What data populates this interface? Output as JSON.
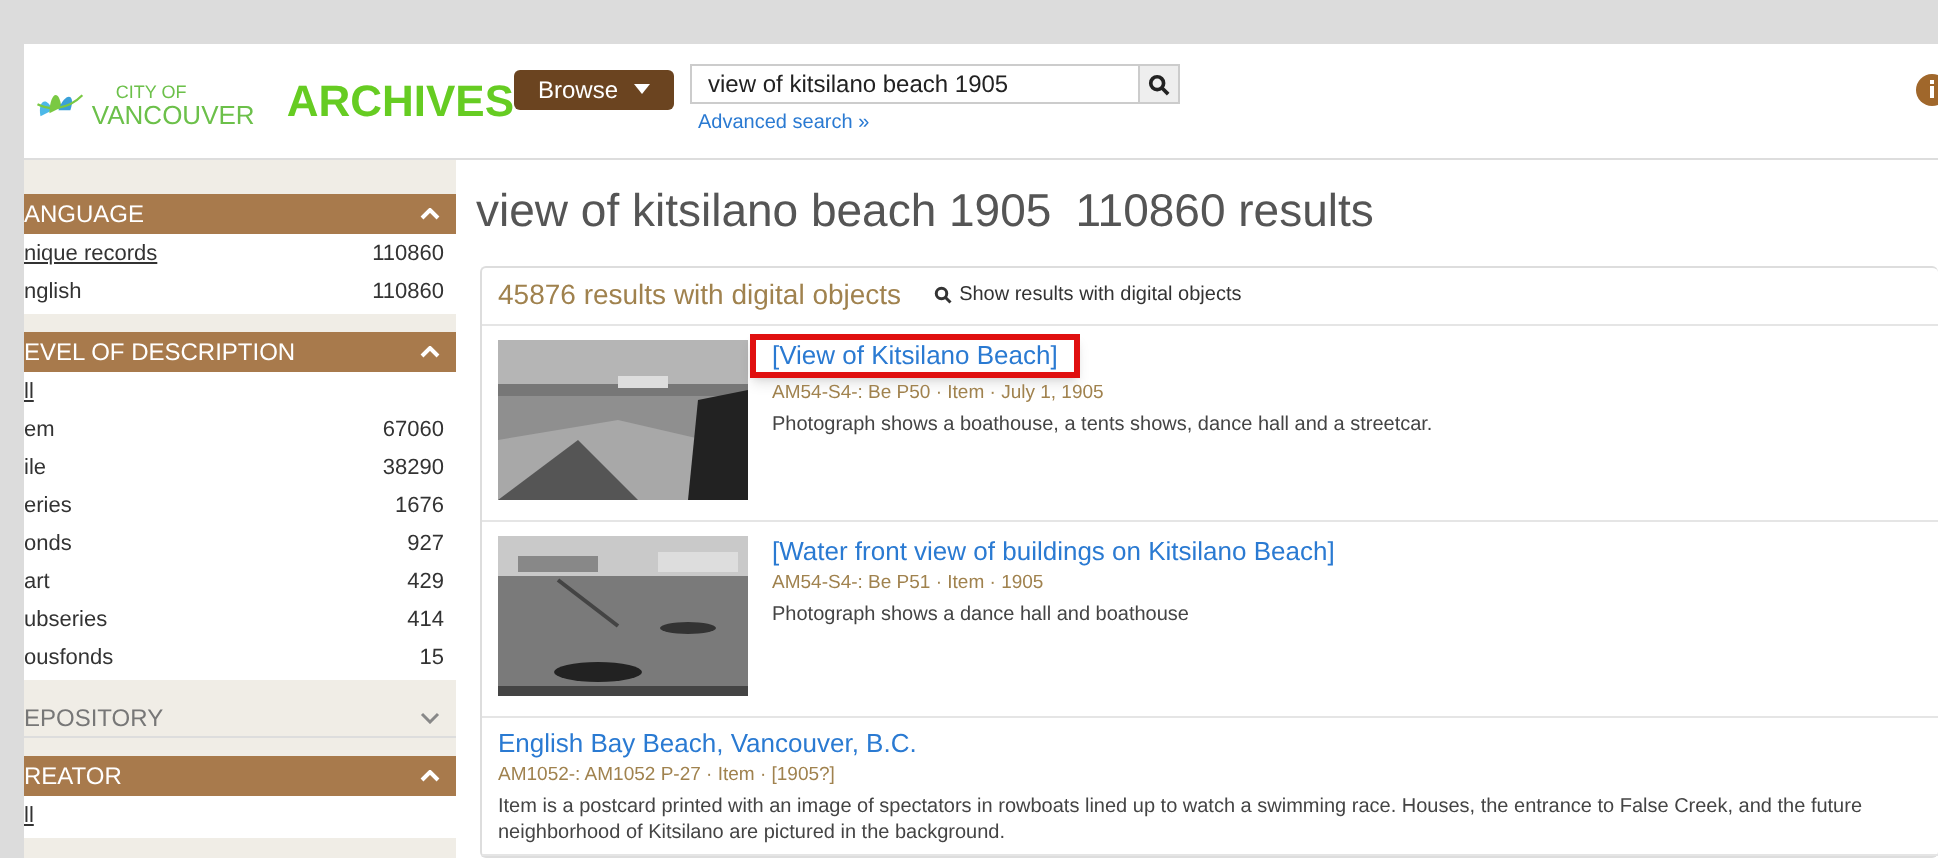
{
  "header": {
    "logo_small": "CITY OF",
    "logo_city": "VANCOUVER",
    "logo_title": "ARCHIVES",
    "browse_button": "Browse",
    "search": {
      "value": "view of kitsilano beach 1905"
    },
    "advanced_search": "Advanced search »"
  },
  "sidebar": {
    "facets": [
      {
        "title": "ANGUAGE",
        "expanded": true,
        "items": [
          {
            "label": "nique records",
            "count": "110860",
            "link": true
          },
          {
            "label": "nglish",
            "count": "110860",
            "link": false
          }
        ]
      },
      {
        "title": "EVEL OF DESCRIPTION",
        "expanded": true,
        "items": [
          {
            "label": "ll",
            "link": true
          },
          {
            "label": "em",
            "count": "67060",
            "link": false
          },
          {
            "label": "ile",
            "count": "38290",
            "link": false
          },
          {
            "label": "eries",
            "count": "1676",
            "link": false
          },
          {
            "label": "onds",
            "count": "927",
            "link": false
          },
          {
            "label": "art",
            "count": "429",
            "link": false
          },
          {
            "label": "ubseries",
            "count": "414",
            "link": false
          },
          {
            "label": "ousfonds",
            "count": "15",
            "link": false
          }
        ]
      },
      {
        "title": "EPOSITORY",
        "expanded": false
      },
      {
        "title": "REATOR",
        "expanded": true,
        "items": [
          {
            "label": "ll",
            "link": true
          }
        ]
      }
    ]
  },
  "results": {
    "heading": "view of kitsilano beach 1905",
    "total": "110860 results",
    "digital_count": "45876 results with digital objects",
    "digital_link": "Show results with digital objects",
    "items": [
      {
        "title": "[View of Kitsilano Beach]",
        "meta": "AM54-S4-: Be P50 · Item · July 1, 1905",
        "description": "Photograph shows a boathouse, a tents shows, dance hall and a streetcar.",
        "thumbnail": true,
        "highlighted": true
      },
      {
        "title": "[Water front view of buildings on Kitsilano Beach]",
        "meta": "AM54-S4-: Be P51 · Item · 1905",
        "description": "Photograph shows a dance hall and boathouse",
        "thumbnail": true,
        "highlighted": false
      },
      {
        "title": "English Bay Beach, Vancouver, B.C.",
        "meta": "AM1052-: AM1052 P-27 · Item · [1905?]",
        "description": "Item is a postcard printed with an image of spectators in rowboats lined up to watch a swimming race. Houses, the entrance to False Creek, and the future neighborhood of Kitsilano are pictured in the background.",
        "thumbnail": false,
        "highlighted": false
      }
    ]
  }
}
